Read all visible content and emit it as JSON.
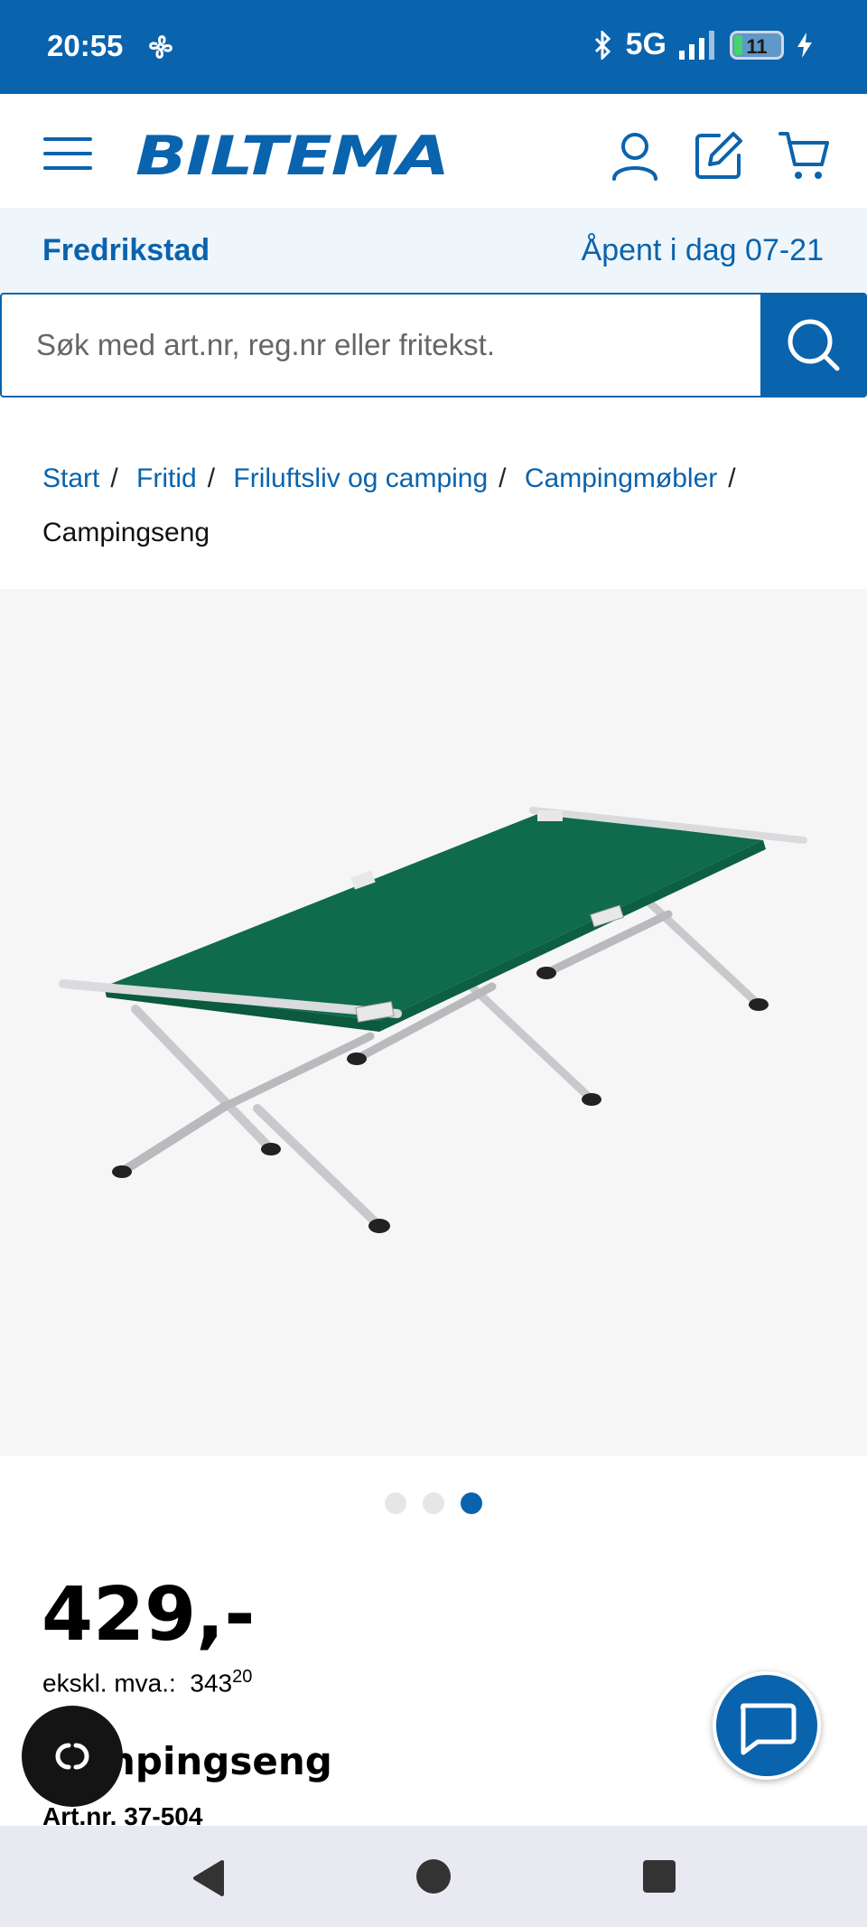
{
  "status_bar": {
    "time": "20:55",
    "network": "5G",
    "battery": "11"
  },
  "header": {
    "brand": "BILTEMA"
  },
  "store": {
    "name": "Fredrikstad",
    "hours": "Åpent i dag 07-21"
  },
  "search": {
    "placeholder": "Søk med art.nr, reg.nr eller fritekst."
  },
  "breadcrumb": {
    "items": [
      "Start",
      "Fritid",
      "Friluftsliv og camping",
      "Campingmøbler"
    ],
    "current": "Campingseng",
    "separator": "/"
  },
  "gallery": {
    "image_alt": "Campingseng",
    "dots": 3,
    "active_index": 2
  },
  "product": {
    "price": "429,-",
    "ex_vat_label": "ekskl. mva.:",
    "ex_vat_whole": "343",
    "ex_vat_cents": "20",
    "name": "Campingseng",
    "art_nr": "Art.nr. 37-504"
  },
  "colors": {
    "brand_blue": "#0a63ad",
    "store_bar_bg": "#eef6fb",
    "gallery_bg": "#f6f6f6",
    "bed_green": "#0f6b4b"
  },
  "icons": [
    "hamburger-icon",
    "user-icon",
    "edit-icon",
    "cart-icon",
    "search-icon",
    "chat-icon",
    "cookie-icon",
    "bluetooth-icon",
    "signal-icon",
    "battery-icon",
    "back-icon",
    "home-icon",
    "recents-icon"
  ]
}
